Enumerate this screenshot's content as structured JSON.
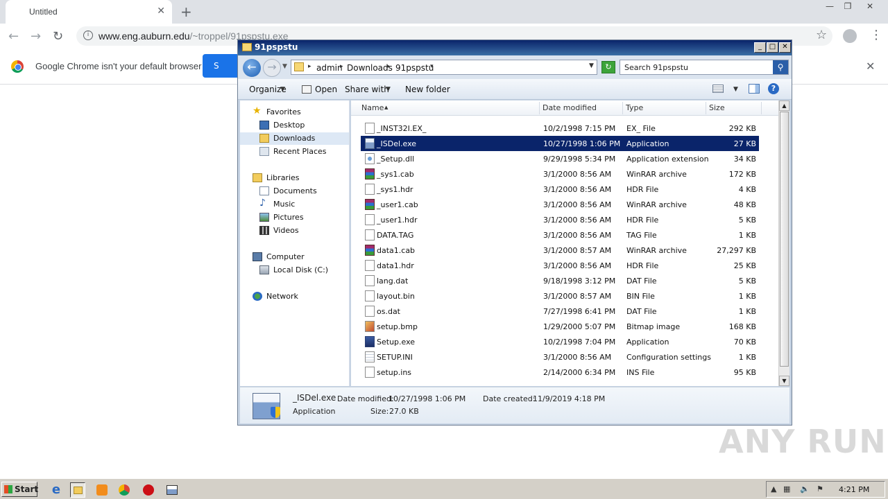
{
  "browser": {
    "tab_title": "Untitled",
    "url_host": "www.eng.auburn.edu",
    "url_path": "/~troppel/91pspstu.exe",
    "infobar_message": "Google Chrome isn't your default browser",
    "infobar_button_label": "S"
  },
  "explorer": {
    "title": "91pspstu",
    "breadcrumb": [
      "admin",
      "Downloads",
      "91pspstu"
    ],
    "search_placeholder": "Search 91pspstu",
    "commands": {
      "organize": "Organize",
      "open": "Open",
      "share_with": "Share with",
      "new_folder": "New folder"
    },
    "nav": {
      "favorites": "Favorites",
      "desktop": "Desktop",
      "downloads": "Downloads",
      "recent_places": "Recent Places",
      "libraries": "Libraries",
      "documents": "Documents",
      "music": "Music",
      "pictures": "Pictures",
      "videos": "Videos",
      "computer": "Computer",
      "local_disk": "Local Disk (C:)",
      "network": "Network"
    },
    "columns": {
      "name": "Name",
      "date_modified": "Date modified",
      "type": "Type",
      "size": "Size"
    },
    "files": [
      {
        "name": "_INST32I.EX_",
        "date": "10/2/1998 7:15 PM",
        "type": "EX_ File",
        "size": "292 KB",
        "icon": "file"
      },
      {
        "name": "_ISDel.exe",
        "date": "10/27/1998 1:06 PM",
        "type": "Application",
        "size": "27 KB",
        "icon": "app"
      },
      {
        "name": "_Setup.dll",
        "date": "9/29/1998 5:34 PM",
        "type": "Application extension",
        "size": "34 KB",
        "icon": "dll"
      },
      {
        "name": "_sys1.cab",
        "date": "3/1/2000 8:56 AM",
        "type": "WinRAR archive",
        "size": "172 KB",
        "icon": "rar"
      },
      {
        "name": "_sys1.hdr",
        "date": "3/1/2000 8:56 AM",
        "type": "HDR File",
        "size": "4 KB",
        "icon": "file"
      },
      {
        "name": "_user1.cab",
        "date": "3/1/2000 8:56 AM",
        "type": "WinRAR archive",
        "size": "48 KB",
        "icon": "rar"
      },
      {
        "name": "_user1.hdr",
        "date": "3/1/2000 8:56 AM",
        "type": "HDR File",
        "size": "5 KB",
        "icon": "file"
      },
      {
        "name": "DATA.TAG",
        "date": "3/1/2000 8:56 AM",
        "type": "TAG File",
        "size": "1 KB",
        "icon": "file"
      },
      {
        "name": "data1.cab",
        "date": "3/1/2000 8:57 AM",
        "type": "WinRAR archive",
        "size": "27,297 KB",
        "icon": "rar"
      },
      {
        "name": "data1.hdr",
        "date": "3/1/2000 8:56 AM",
        "type": "HDR File",
        "size": "25 KB",
        "icon": "file"
      },
      {
        "name": "lang.dat",
        "date": "9/18/1998 3:12 PM",
        "type": "DAT File",
        "size": "5 KB",
        "icon": "file"
      },
      {
        "name": "layout.bin",
        "date": "3/1/2000 8:57 AM",
        "type": "BIN File",
        "size": "1 KB",
        "icon": "file"
      },
      {
        "name": "os.dat",
        "date": "7/27/1998 6:41 PM",
        "type": "DAT File",
        "size": "1 KB",
        "icon": "file"
      },
      {
        "name": "setup.bmp",
        "date": "1/29/2000 5:07 PM",
        "type": "Bitmap image",
        "size": "168 KB",
        "icon": "bmp"
      },
      {
        "name": "Setup.exe",
        "date": "10/2/1998 7:04 PM",
        "type": "Application",
        "size": "70 KB",
        "icon": "setup"
      },
      {
        "name": "SETUP.INI",
        "date": "3/1/2000 8:56 AM",
        "type": "Configuration settings",
        "size": "1 KB",
        "icon": "ini"
      },
      {
        "name": "setup.ins",
        "date": "2/14/2000 6:34 PM",
        "type": "INS File",
        "size": "95 KB",
        "icon": "file"
      }
    ],
    "selected_index": 1,
    "details": {
      "name": "_ISDel.exe",
      "type": "Application",
      "date_modified_label": "Date modified:",
      "date_modified": "10/27/1998 1:06 PM",
      "date_created_label": "Date created:",
      "date_created": "11/9/2019 4:18 PM",
      "size_label": "Size:",
      "size": "27.0 KB"
    }
  },
  "watermark": "ANY RUN",
  "taskbar": {
    "start_label": "Start",
    "clock": "4:21 PM"
  }
}
